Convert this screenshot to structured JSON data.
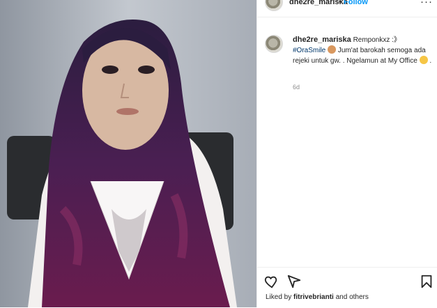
{
  "post": {
    "username": "dhe2re_mariska",
    "follow_label": "Follow",
    "separator": "•",
    "more_label": "···",
    "caption": {
      "username": "dhe2re_mariska",
      "text_1": "Remponkxz :》",
      "hashtag": "#OraSmile",
      "text_2": "Jum'at barokah semoga ada rejeki untuk gw. . Ngelamun at My Office",
      "text_3": "."
    },
    "time_ago": "6d",
    "likes": {
      "prefix": "Liked by",
      "user": "fitrivebrianti",
      "suffix": "and others"
    },
    "icons": [
      "more-icon",
      "heart-icon",
      "share-icon",
      "bookmark-icon"
    ]
  }
}
